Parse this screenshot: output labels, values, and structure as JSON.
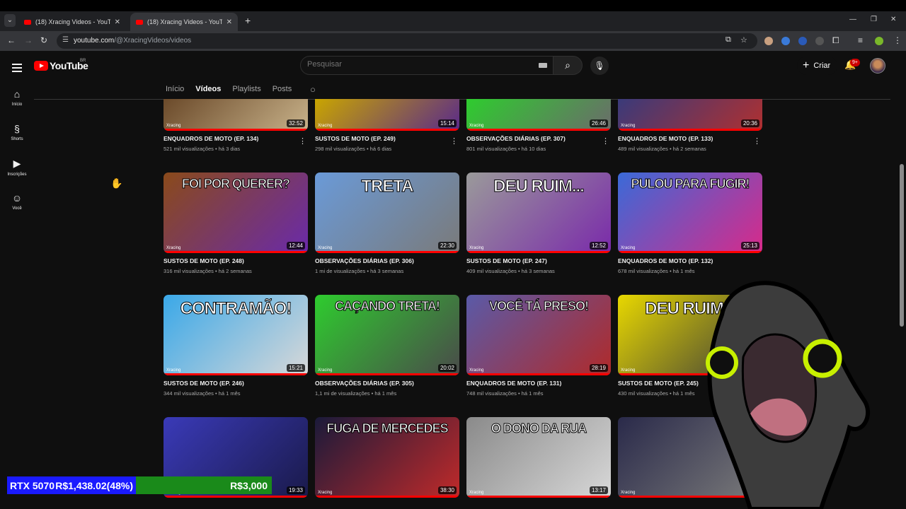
{
  "browser": {
    "tabs": [
      {
        "title": "(18) Xracing Videos - YouTube",
        "active": false
      },
      {
        "title": "(18) Xracing Videos - YouTube",
        "active": true
      }
    ],
    "url_host": "youtube.com",
    "url_path": "/@XracingVideos/videos"
  },
  "header": {
    "logo_text": "YouTube",
    "region": "BR",
    "search_placeholder": "Pesquisar",
    "create_label": "Criar",
    "notification_count": "9+"
  },
  "sidebar": [
    {
      "label": "Início",
      "icon": "home-icon"
    },
    {
      "label": "Shorts",
      "icon": "shorts-icon"
    },
    {
      "label": "Inscrições",
      "icon": "subscriptions-icon"
    },
    {
      "label": "Você",
      "icon": "you-icon"
    }
  ],
  "channel_tabs": [
    "Início",
    "Vídeos",
    "Playlists",
    "Posts"
  ],
  "videos": [
    {
      "title": "ENQUADROS DE MOTO (EP. 134)",
      "views": "521 mil visualizações",
      "age": "há 3 dias",
      "duration": "32:52",
      "thumb_text": "",
      "colors": [
        "#6b4a2a",
        "#c8b28a"
      ]
    },
    {
      "title": "SUSTOS DE MOTO (EP. 249)",
      "views": "298 mil visualizações",
      "age": "há 6 dias",
      "duration": "15:14",
      "thumb_text": "",
      "colors": [
        "#c9a500",
        "#5a2a8a"
      ]
    },
    {
      "title": "OBSERVAÇÕES DIÁRIAS (EP. 307)",
      "views": "801 mil visualizações",
      "age": "há 10 dias",
      "duration": "26:46",
      "thumb_text": "",
      "colors": [
        "#2ecc2e",
        "#6b6b6b"
      ]
    },
    {
      "title": "ENQUADROS DE MOTO (EP. 133)",
      "views": "489 mil visualizações",
      "age": "há 2 semanas",
      "duration": "20:36",
      "thumb_text": "",
      "colors": [
        "#3a3a7a",
        "#b03030"
      ]
    },
    {
      "title": "SUSTOS DE MOTO (EP. 248)",
      "views": "316 mil visualizações",
      "age": "há 2 semanas",
      "duration": "12:44",
      "thumb_text": "FOI POR QUERER?",
      "colors": [
        "#8a4a1a",
        "#6a2aaa"
      ]
    },
    {
      "title": "OBSERVAÇÕES DIÁRIAS (EP. 306)",
      "views": "1 mi de visualizações",
      "age": "há 3 semanas",
      "duration": "22:30",
      "thumb_text": "TRETA",
      "colors": [
        "#6a9ad8",
        "#7a7a7a"
      ]
    },
    {
      "title": "SUSTOS DE MOTO (EP. 247)",
      "views": "409 mil visualizações",
      "age": "há 3 semanas",
      "duration": "12:52",
      "thumb_text": "DEU RUIM...",
      "colors": [
        "#9a9a9a",
        "#7a2aaa"
      ]
    },
    {
      "title": "ENQUADROS DE MOTO (EP. 132)",
      "views": "678 mil visualizações",
      "age": "há 1 mês",
      "duration": "25:13",
      "thumb_text": "PULOU PARA FUGIR!",
      "colors": [
        "#3a6ad8",
        "#d82a8a"
      ]
    },
    {
      "title": "SUSTOS DE MOTO (EP. 246)",
      "views": "344 mil visualizações",
      "age": "há 1 mês",
      "duration": "15:21",
      "thumb_text": "CONTRAMÃO!",
      "colors": [
        "#3aa8e8",
        "#d8d8d8"
      ]
    },
    {
      "title": "OBSERVAÇÕES DIÁRIAS (EP. 305)",
      "views": "1,1 mi de visualizações",
      "age": "há 1 mês",
      "duration": "20:02",
      "thumb_text": "CAÇANDO TRETA!",
      "colors": [
        "#2ecc2e",
        "#4a4a4a"
      ]
    },
    {
      "title": "ENQUADROS DE MOTO (EP. 131)",
      "views": "748 mil visualizações",
      "age": "há 1 mês",
      "duration": "28:19",
      "thumb_text": "VOCÊ TÁ PRESO!",
      "colors": [
        "#5a5aa8",
        "#b02a2a"
      ]
    },
    {
      "title": "SUSTOS DE MOTO (EP. 245)",
      "views": "430 mil visualizações",
      "age": "há 1 mês",
      "duration": "",
      "thumb_text": "DEU RUIM...",
      "colors": [
        "#e8d800",
        "#3a3a3a"
      ]
    },
    {
      "title": "",
      "views": "",
      "age": "",
      "duration": "19:33",
      "thumb_text": "",
      "colors": [
        "#3a3ab8",
        "#1a1a4a"
      ]
    },
    {
      "title": "",
      "views": "",
      "age": "",
      "duration": "38:30",
      "thumb_text": "FUGA DE MERCEDES",
      "colors": [
        "#1a1a3a",
        "#c02a2a"
      ]
    },
    {
      "title": "",
      "views": "",
      "age": "",
      "duration": "13:17",
      "thumb_text": "O DONO DA RUA",
      "colors": [
        "#8a8a8a",
        "#d8d8d8"
      ]
    },
    {
      "title": "",
      "views": "",
      "age": "",
      "duration": "",
      "thumb_text": "",
      "colors": [
        "#2a2a4a",
        "#7a7a7a"
      ]
    }
  ],
  "watermark": "Xracing",
  "overlay": {
    "gpu": "RTX 5070",
    "progress": "R$1,438.02(48%)",
    "goal": "R$3,000"
  }
}
